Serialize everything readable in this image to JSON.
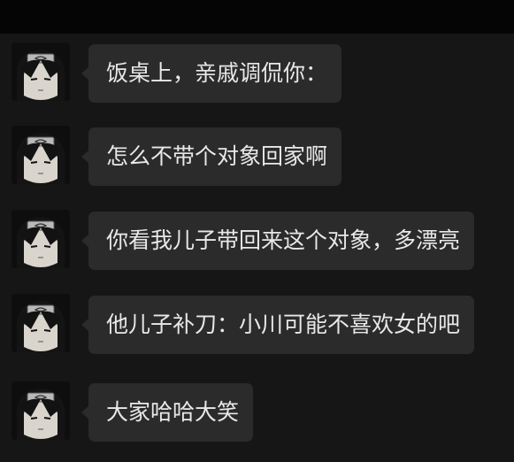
{
  "messages": [
    {
      "text": "饭桌上，亲戚调侃你："
    },
    {
      "text": "怎么不带个对象回家啊"
    },
    {
      "text": "你看我儿子带回来这个对象，多漂亮"
    },
    {
      "text": "他儿子补刀：小川可能不喜欢女的吧"
    },
    {
      "text": "大家哈哈大笑"
    }
  ],
  "colors": {
    "background": "#161616",
    "top_bar": "#050505",
    "bubble": "#2b2b2b",
    "text": "#e8e8e8"
  }
}
